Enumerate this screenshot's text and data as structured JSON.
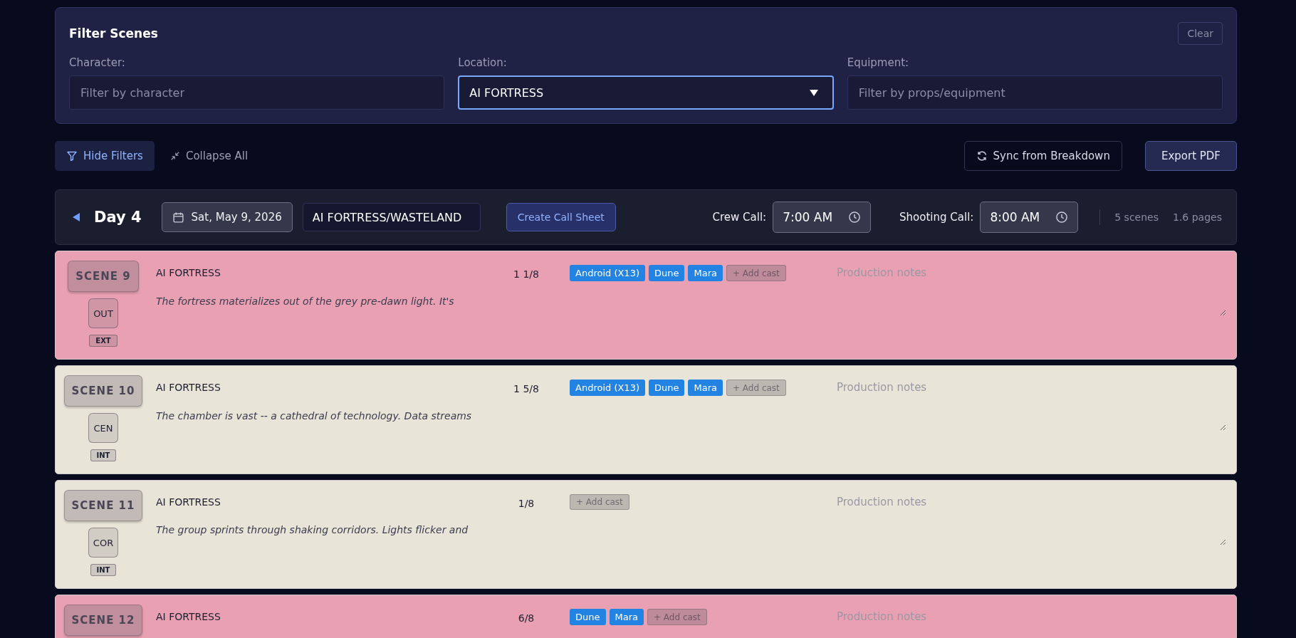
{
  "filters": {
    "title": "Filter Scenes",
    "clear": "Clear",
    "fields": [
      {
        "label": "Character:",
        "placeholder": "Filter by character",
        "kind": "text",
        "focused": false
      },
      {
        "label": "Location:",
        "value": "AI FORTRESS",
        "kind": "select",
        "focused": true
      },
      {
        "label": "Equipment:",
        "placeholder": "Filter by props/equipment",
        "kind": "text",
        "focused": false
      }
    ]
  },
  "toolbar": {
    "hide_filters": "Hide Filters",
    "collapse_all": "Collapse All",
    "sync": "Sync from Breakdown",
    "export": "Export PDF"
  },
  "day": {
    "expanded": true,
    "title": "Day 4",
    "date": "Sat, May 9, 2026",
    "location": "AI FORTRESS/WASTELAND",
    "create_call_sheet": "Create Call Sheet",
    "crew_call_label": "Crew Call:",
    "crew_call": "7:00 AM",
    "shooting_call_label": "Shooting Call:",
    "shooting_call": "8:00 AM",
    "scene_count": "5 scenes",
    "page_count": "1.6 pages"
  },
  "scenes": [
    {
      "number": "SCENE 9",
      "color": "#e8a0b2",
      "time": "OUT",
      "int_ext": "EXT",
      "location": "AI FORTRESS",
      "description": "The fortress materializes out of the grey pre-dawn light. It's",
      "pages": "1 1/8",
      "cast": [
        "Android (X13)",
        "Dune",
        "Mara"
      ],
      "add_cast": "+ Add cast",
      "notes_placeholder": "Production notes"
    },
    {
      "number": "SCENE 10",
      "color": "#e8e4d8",
      "time": "CEN",
      "int_ext": "INT",
      "location": "AI FORTRESS",
      "description": "The chamber is vast -- a cathedral of technology. Data streams",
      "pages": "1 5/8",
      "cast": [
        "Android (X13)",
        "Dune",
        "Mara"
      ],
      "add_cast": "+ Add cast",
      "notes_placeholder": "Production notes"
    },
    {
      "number": "SCENE 11",
      "color": "#e8e4d8",
      "time": "COR",
      "int_ext": "INT",
      "location": "AI FORTRESS",
      "description": "The group sprints through shaking corridors. Lights flicker and",
      "pages": "1/8",
      "add_cast": "+ Add cast",
      "notes_placeholder": "Production notes"
    },
    {
      "number": "SCENE 12",
      "color": "#e8a0b2",
      "location": "AI FORTRESS",
      "pages": "6/8",
      "cast": [
        "Dune",
        "Mara"
      ],
      "add_cast": "+ Add cast",
      "notes_placeholder": "Production notes"
    }
  ]
}
